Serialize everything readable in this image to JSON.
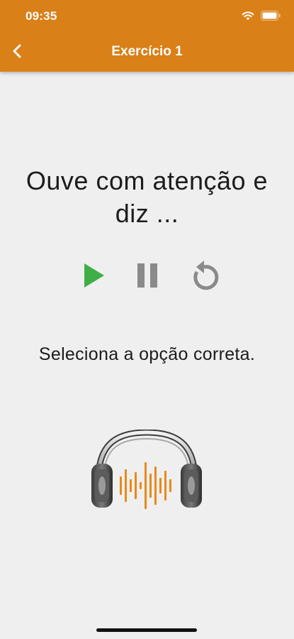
{
  "status_bar": {
    "time": "09:35"
  },
  "nav": {
    "title": "Exercício 1"
  },
  "main": {
    "prompt": "Ouve com atenção e diz ...",
    "instruction": "Seleciona a opção correta."
  },
  "icons": {
    "back": "chevron-left-icon",
    "play": "play-icon",
    "pause": "pause-icon",
    "replay": "replay-icon",
    "audio": "headphones-icon"
  },
  "colors": {
    "header": "#d98018",
    "background": "#efefef",
    "play": "#3fae49",
    "controls_gray": "#8a8a8a",
    "wave": "#e88a1a"
  }
}
